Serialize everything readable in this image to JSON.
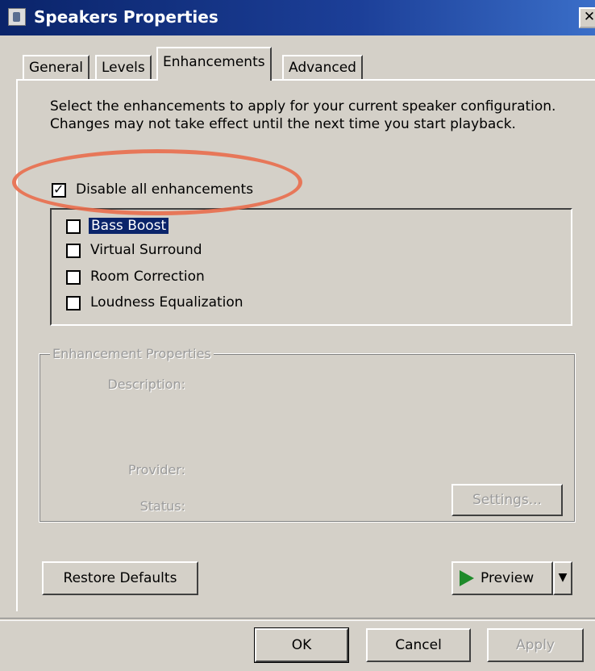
{
  "window": {
    "title": "Speakers Properties",
    "close_glyph": "✕"
  },
  "tabs": [
    {
      "label": "General"
    },
    {
      "label": "Levels"
    },
    {
      "label": "Enhancements"
    },
    {
      "label": "Advanced"
    }
  ],
  "intro_text": "Select the enhancements to apply for your current speaker configuration. Changes may not take effect until the next time you start playback.",
  "disable_all": {
    "label": "Disable all enhancements",
    "checked": true
  },
  "enhancements": [
    {
      "label": "Bass Boost",
      "checked": false
    },
    {
      "label": "Virtual Surround",
      "checked": false
    },
    {
      "label": "Room Correction",
      "checked": false
    },
    {
      "label": "Loudness Equalization",
      "checked": false
    }
  ],
  "properties": {
    "legend": "Enhancement Properties",
    "description_label": "Description:",
    "provider_label": "Provider:",
    "status_label": "Status:",
    "settings_button": "Settings..."
  },
  "buttons": {
    "restore_defaults": "Restore Defaults",
    "preview": "Preview",
    "ok": "OK",
    "cancel": "Cancel",
    "apply": "Apply"
  },
  "colors": {
    "highlight": "#e96d4d",
    "play": "#1e8a2a",
    "selection": "#0a246a"
  }
}
